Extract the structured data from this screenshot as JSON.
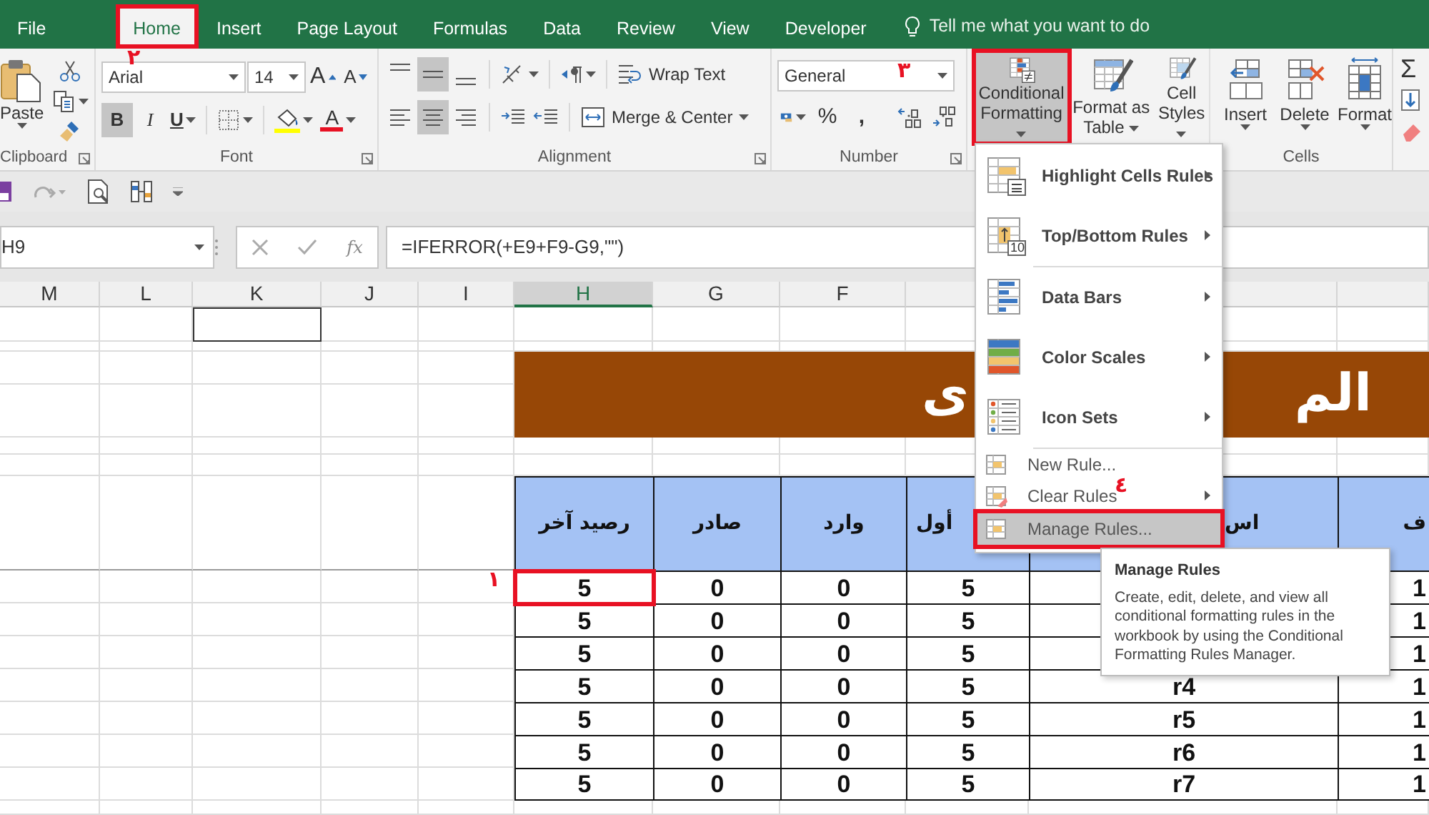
{
  "tabs": [
    {
      "label": "File",
      "selected": false
    },
    {
      "label": "Home",
      "selected": true
    },
    {
      "label": "Insert",
      "selected": false
    },
    {
      "label": "Page Layout",
      "selected": false
    },
    {
      "label": "Formulas",
      "selected": false
    },
    {
      "label": "Data",
      "selected": false
    },
    {
      "label": "Review",
      "selected": false
    },
    {
      "label": "View",
      "selected": false
    },
    {
      "label": "Developer",
      "selected": false
    }
  ],
  "tell_me": {
    "placeholder": "Tell me what you want to do"
  },
  "clipboard": {
    "paste": "Paste",
    "label": "Clipboard"
  },
  "font": {
    "name": "Arial",
    "size": "14",
    "grow": "A",
    "shrink": "A",
    "font_color": "A",
    "label": "Font",
    "styles": [
      {
        "label": "B",
        "active": true
      },
      {
        "label": "I",
        "active": false
      },
      {
        "label": "U",
        "active": false
      }
    ]
  },
  "alignment": {
    "vertical": [
      {
        "kind": "top",
        "active": false
      },
      {
        "kind": "middle",
        "active": true
      },
      {
        "kind": "bottom",
        "active": false
      }
    ],
    "horizontal": [
      {
        "kind": "left",
        "active": false
      },
      {
        "kind": "center",
        "active": true
      },
      {
        "kind": "right",
        "active": false
      }
    ],
    "wrap": "Wrap Text",
    "merge": "Merge & Center",
    "label": "Alignment"
  },
  "number": {
    "format": "General",
    "percent": "%",
    "comma": ",",
    "label": "Number"
  },
  "styles": [
    {
      "kind": "conditional",
      "label": "Conditional Formatting",
      "selected": true
    },
    {
      "kind": "table",
      "label": "Format as Table",
      "selected": false
    },
    {
      "kind": "cellstyles",
      "label": "Cell Styles",
      "selected": false
    }
  ],
  "cells": {
    "buttons": [
      {
        "kind": "insert",
        "label": "Insert"
      },
      {
        "kind": "delete",
        "label": "Delete"
      },
      {
        "kind": "format",
        "label": "Format"
      }
    ],
    "label": "Cells"
  },
  "editing": {
    "sum": "Σ"
  },
  "name_box": "H9",
  "fx": "fx",
  "formula": "=IFERROR(+E9+F9-G9,\"\")",
  "columns": [
    {
      "label": "M",
      "selected": false
    },
    {
      "label": "L",
      "selected": false
    },
    {
      "label": "K",
      "selected": false
    },
    {
      "label": "J",
      "selected": false
    },
    {
      "label": "I",
      "selected": false
    },
    {
      "label": "H",
      "selected": true
    },
    {
      "label": "G",
      "selected": false
    },
    {
      "label": "F",
      "selected": false
    }
  ],
  "title_fragments": [
    "الم",
    "ى"
  ],
  "table": {
    "columns": [
      {
        "header": "ف",
        "cells": [
          {
            "text": "1",
            "selected": false
          },
          {
            "text": "1",
            "selected": false
          },
          {
            "text": "1",
            "selected": false
          },
          {
            "text": "1",
            "selected": false
          },
          {
            "text": "1",
            "selected": false
          },
          {
            "text": "1",
            "selected": false
          },
          {
            "text": "1",
            "selected": false
          }
        ]
      },
      {
        "header": "اس",
        "cells": [
          null,
          null,
          null,
          {
            "text": "r4",
            "selected": false
          },
          {
            "text": "r5",
            "selected": false
          },
          {
            "text": "r6",
            "selected": false
          },
          {
            "text": "r7",
            "selected": false
          }
        ]
      },
      {
        "header": "أول",
        "cells": [
          {
            "text": "5",
            "selected": false
          },
          {
            "text": "5",
            "selected": false
          },
          {
            "text": "5",
            "selected": false
          },
          {
            "text": "5",
            "selected": false
          },
          {
            "text": "5",
            "selected": false
          },
          {
            "text": "5",
            "selected": false
          },
          {
            "text": "5",
            "selected": false
          }
        ]
      },
      {
        "header": "وارد",
        "cells": [
          {
            "text": "0",
            "selected": false
          },
          {
            "text": "0",
            "selected": false
          },
          {
            "text": "0",
            "selected": false
          },
          {
            "text": "0",
            "selected": false
          },
          {
            "text": "0",
            "selected": false
          },
          {
            "text": "0",
            "selected": false
          },
          {
            "text": "0",
            "selected": false
          }
        ]
      },
      {
        "header": "صادر",
        "cells": [
          {
            "text": "0",
            "selected": false
          },
          {
            "text": "0",
            "selected": false
          },
          {
            "text": "0",
            "selected": false
          },
          {
            "text": "0",
            "selected": false
          },
          {
            "text": "0",
            "selected": false
          },
          {
            "text": "0",
            "selected": false
          },
          {
            "text": "0",
            "selected": false
          }
        ]
      },
      {
        "header": "رصيد آخر",
        "cells": [
          {
            "text": "5",
            "selected": true
          },
          {
            "text": "5",
            "selected": false
          },
          {
            "text": "5",
            "selected": false
          },
          {
            "text": "5",
            "selected": false
          },
          {
            "text": "5",
            "selected": false
          },
          {
            "text": "5",
            "selected": false
          },
          {
            "text": "5",
            "selected": false
          }
        ]
      }
    ]
  },
  "menu": {
    "items": [
      {
        "kind": "large",
        "label": "Highlight Cells Rules",
        "submenu": true,
        "separator_before": false,
        "selected": false
      },
      {
        "kind": "large",
        "label": "Top/Bottom Rules",
        "badge": "10",
        "submenu": true,
        "separator_before": false,
        "selected": false
      },
      {
        "kind": "large",
        "label": "Data Bars",
        "submenu": true,
        "separator_before": true,
        "selected": false
      },
      {
        "kind": "large",
        "label": "Color Scales",
        "submenu": true,
        "separator_before": false,
        "selected": false
      },
      {
        "kind": "large",
        "label": "Icon Sets",
        "submenu": true,
        "separator_before": false,
        "selected": false
      },
      {
        "kind": "small",
        "label": "New Rule...",
        "submenu": false,
        "separator_before": true,
        "selected": false
      },
      {
        "kind": "small",
        "label": "Clear Rules",
        "submenu": true,
        "separator_before": false,
        "selected": false
      },
      {
        "kind": "small",
        "label": "Manage Rules...",
        "submenu": false,
        "separator_before": false,
        "selected": true
      }
    ]
  },
  "tooltip": {
    "title": "Manage Rules",
    "text": "Create, edit, delete, and view all conditional formatting rules in the workbook by using the Conditional Formatting Rules Manager."
  },
  "annotations": [
    {
      "text": "٢"
    },
    {
      "text": "٣"
    },
    {
      "text": "٤"
    },
    {
      "text": "١"
    }
  ]
}
